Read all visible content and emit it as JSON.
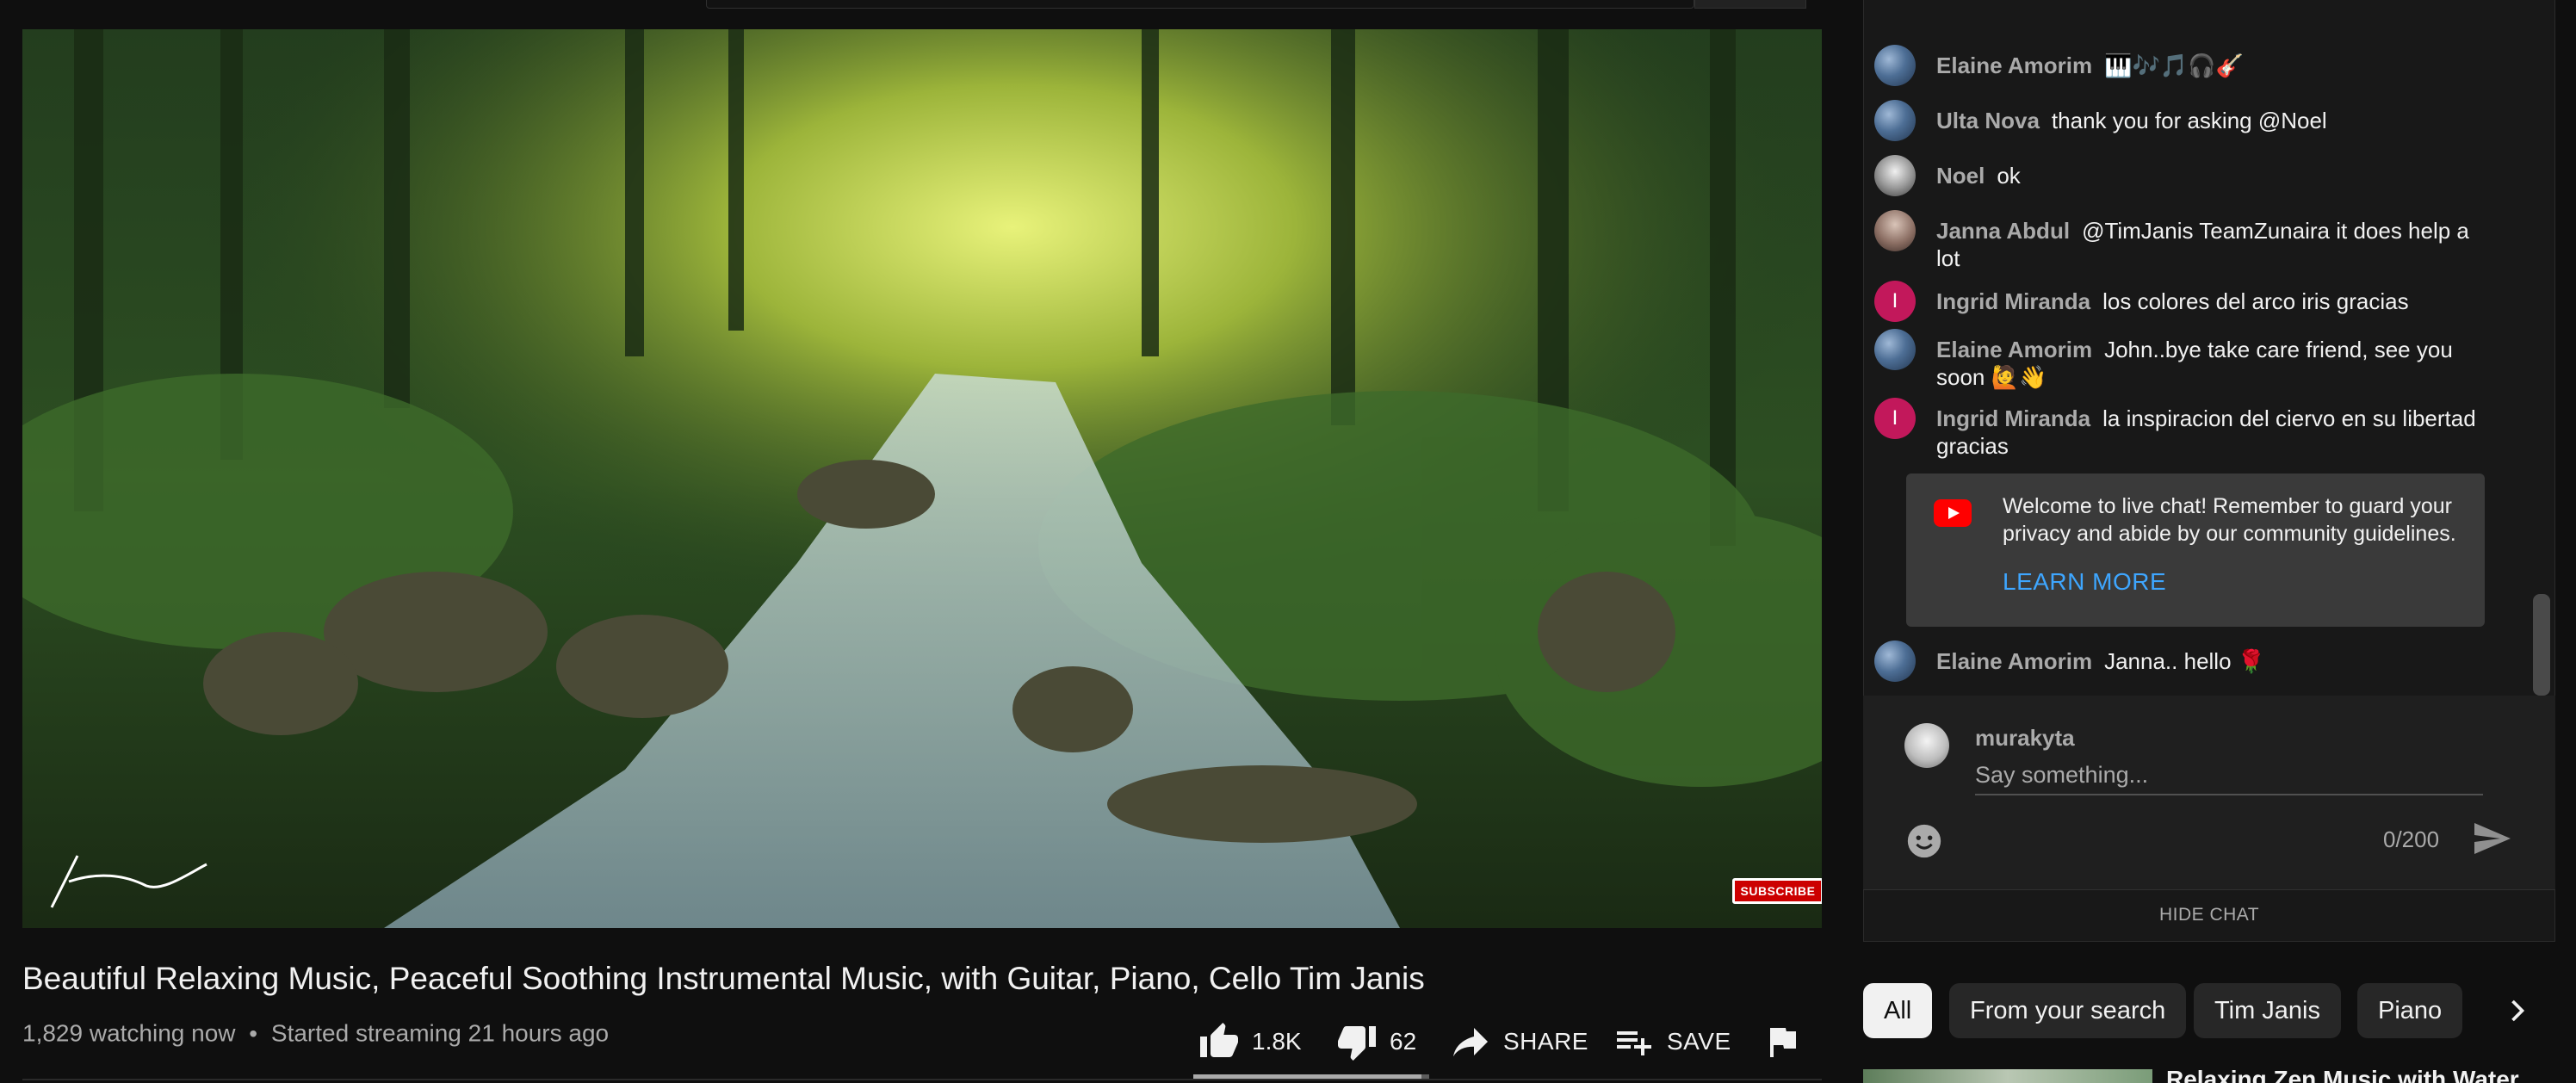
{
  "video": {
    "title": "Beautiful Relaxing Music, Peaceful Soothing Instrumental Music, with Guitar, Piano, Cello Tim Janis",
    "viewers": "1,829 watching now",
    "separator": "•",
    "started": "Started streaming 21 hours ago",
    "subscribe_badge": "SUBSCRIBE",
    "likes": "1.8K",
    "dislikes": "62",
    "like_ratio": 0.967,
    "share_label": "SHARE",
    "save_label": "SAVE"
  },
  "chat": {
    "messages": [
      {
        "author": "Elaine Amorim",
        "text": "🎹🎶🎵🎧🎸"
      },
      {
        "author": "Ulta Nova",
        "text": "thank you for asking @Noel"
      },
      {
        "author": "Noel",
        "text": "ok"
      },
      {
        "author": "Janna Abdul",
        "text": "@TimJanis TeamZunaira it does help a lot"
      },
      {
        "author": "Ingrid Miranda",
        "avatar_letter": "I",
        "text": "los colores del arco iris gracias"
      },
      {
        "author": "Elaine Amorim",
        "text": "John..bye take care friend, see you soon 🙋👋"
      },
      {
        "author": "Ingrid Miranda",
        "avatar_letter": "I",
        "text": "la inspiracion del ciervo en su libertad gracias"
      },
      {
        "author": "Elaine Amorim",
        "text": "Janna.. hello 🌹"
      }
    ],
    "welcome_text": "Welcome to live chat! Remember to guard your privacy and abide by our community guidelines.",
    "learn_more": "LEARN MORE",
    "current_user": "murakyta",
    "input_placeholder": "Say something...",
    "char_count": "0/200",
    "hide_chat": "HIDE CHAT"
  },
  "chips": [
    "All",
    "From your search",
    "Tim Janis",
    "Piano"
  ],
  "recommendation": {
    "title": "Relaxing Zen Music with Water"
  },
  "colors": {
    "background": "#0f0f0f",
    "chat_bg": "#181818",
    "accent_link": "#3ea6ff",
    "brand_red": "#ff0000",
    "avatar_letter_bg": "#c2185b"
  },
  "icons": [
    "like-icon",
    "dislike-icon",
    "share-icon",
    "save-playlist-icon",
    "flag-icon",
    "emoji-icon",
    "send-icon",
    "youtube-icon",
    "chevron-right-icon"
  ]
}
